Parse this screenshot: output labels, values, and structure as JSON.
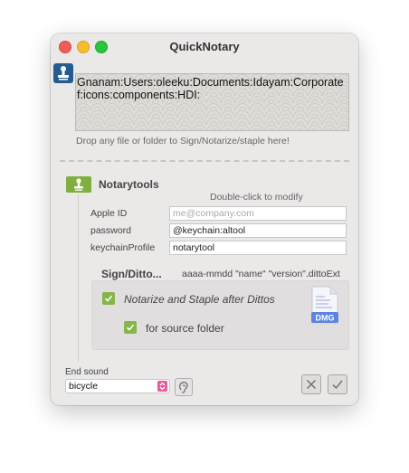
{
  "window": {
    "title": "QuickNotary"
  },
  "drop_zone": {
    "path": "Gnanam:Users:oleeku:Documents:Idayam:Corporate f:icons:components:HDI:",
    "hint": "Drop any file or folder to Sign/Notarize/staple here!"
  },
  "notarytools": {
    "title": "Notarytools",
    "hint": "Double-click to modify",
    "fields": [
      {
        "label": "Apple ID",
        "value": "",
        "placeholder": "me@company.com"
      },
      {
        "label": "password",
        "value": "@keychain:altool",
        "placeholder": ""
      },
      {
        "label": "keychainProfile",
        "value": "notarytool",
        "placeholder": ""
      }
    ]
  },
  "sign_ditto": {
    "title": "Sign/Ditto...",
    "format": "aaaa-mmdd \"name\" \"version\".dittoExt",
    "option_notarize": {
      "label": "Notarize and Staple after Dittos",
      "checked": true
    },
    "option_source": {
      "label": "for source folder",
      "checked": true
    },
    "dmg_badge": "DMG"
  },
  "end_sound": {
    "label": "End sound",
    "selected": "bicycle"
  },
  "colors": {
    "check_green": "#86b64a",
    "popup_pink": "#e75a9c",
    "app_icon_blue": "#245c8f",
    "dmg_blue": "#5b84e0"
  },
  "icons": [
    "app-icon",
    "notary-icon",
    "checkmark-icon",
    "dmg-file-icon",
    "popup-arrows-icon",
    "ear-icon",
    "close-icon",
    "checkmark-icon"
  ]
}
